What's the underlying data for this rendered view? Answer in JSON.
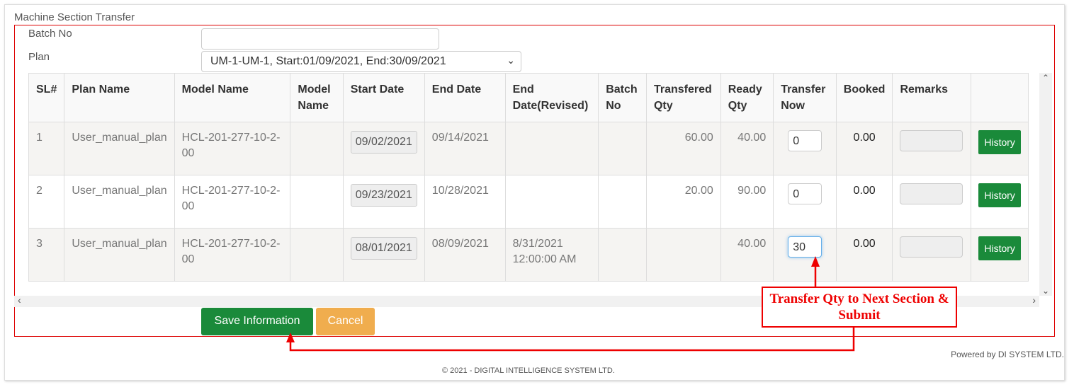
{
  "title": "Machine Section Transfer",
  "form": {
    "batch_label": "Batch No",
    "batch_value": "",
    "plan_label": "Plan",
    "plan_selected": "UM-1-UM-1, Start:01/09/2021, End:30/09/2021"
  },
  "table": {
    "headers": [
      "SL#",
      "Plan Name",
      "Model Name",
      "Model Name",
      "Start Date",
      "End Date",
      "End Date(Revised)",
      "Batch No",
      "Transfered Qty",
      "Ready Qty",
      "Transfer Now",
      "Booked",
      "Remarks",
      ""
    ],
    "rows": [
      {
        "sl": "1",
        "plan": "User_manual_plan",
        "model": "HCL-201-277-10-2-00",
        "model_name": "",
        "start": "09/02/2021",
        "end": "09/14/2021",
        "end_revised": "",
        "batch": "",
        "transfered": "60.00",
        "ready": "40.00",
        "transfer_now": "0",
        "booked": "0.00",
        "remarks": "",
        "history": "History"
      },
      {
        "sl": "2",
        "plan": "User_manual_plan",
        "model": "HCL-201-277-10-2-00",
        "model_name": "",
        "start": "09/23/2021",
        "end": "10/28/2021",
        "end_revised": "",
        "batch": "",
        "transfered": "20.00",
        "ready": "90.00",
        "transfer_now": "0",
        "booked": "0.00",
        "remarks": "",
        "history": "History"
      },
      {
        "sl": "3",
        "plan": "User_manual_plan",
        "model": "HCL-201-277-10-2-00",
        "model_name": "",
        "start": "08/01/2021",
        "end": "08/09/2021",
        "end_revised": "8/31/2021 12:00:00 AM",
        "batch": "",
        "transfered": "",
        "ready": "40.00",
        "transfer_now": "30",
        "booked": "0.00",
        "remarks": "",
        "history": "History"
      }
    ]
  },
  "buttons": {
    "save": "Save Information",
    "cancel": "Cancel"
  },
  "annotation": "Transfer Qty to Next Section & Submit",
  "footer": {
    "powered": "Powered by DI SYSTEM LTD.",
    "copyright": "© 2021 - DIGITAL INTELLIGENCE SYSTEM LTD."
  },
  "colors": {
    "save": "#1a8a3a",
    "cancel": "#f0ad4e",
    "annotation": "#e00000"
  }
}
